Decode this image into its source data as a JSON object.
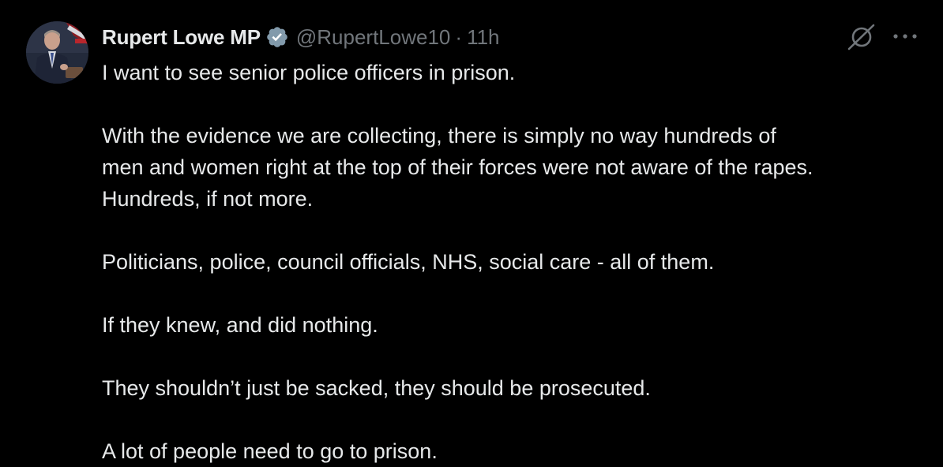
{
  "author": {
    "display_name": "Rupert Lowe MP",
    "handle": "@RupertLowe10",
    "separator": "·",
    "timestamp": "11h",
    "verified": true,
    "verified_color": "#829aab"
  },
  "icons": {
    "avatar": "avatar-photo",
    "verified": "verified-badge-icon",
    "grok": "grok-icon",
    "more": "more-options-icon"
  },
  "tweet": {
    "paragraphs": [
      [
        "I want to see senior police officers in prison."
      ],
      [
        "With the evidence we are collecting, there is simply no way hundreds of",
        "men and women right at the top of their forces were not aware of the rapes.",
        "Hundreds, if not more."
      ],
      [
        "Politicians, police, council officials, NHS, social care - all of them."
      ],
      [
        "If they knew, and did nothing."
      ],
      [
        "They shouldn’t just be sacked, they should be prosecuted."
      ],
      [
        "A lot of people need to go to prison."
      ]
    ]
  },
  "colors": {
    "background": "#000000",
    "primary_text": "#e7e9ea",
    "secondary_text": "#71767b"
  }
}
